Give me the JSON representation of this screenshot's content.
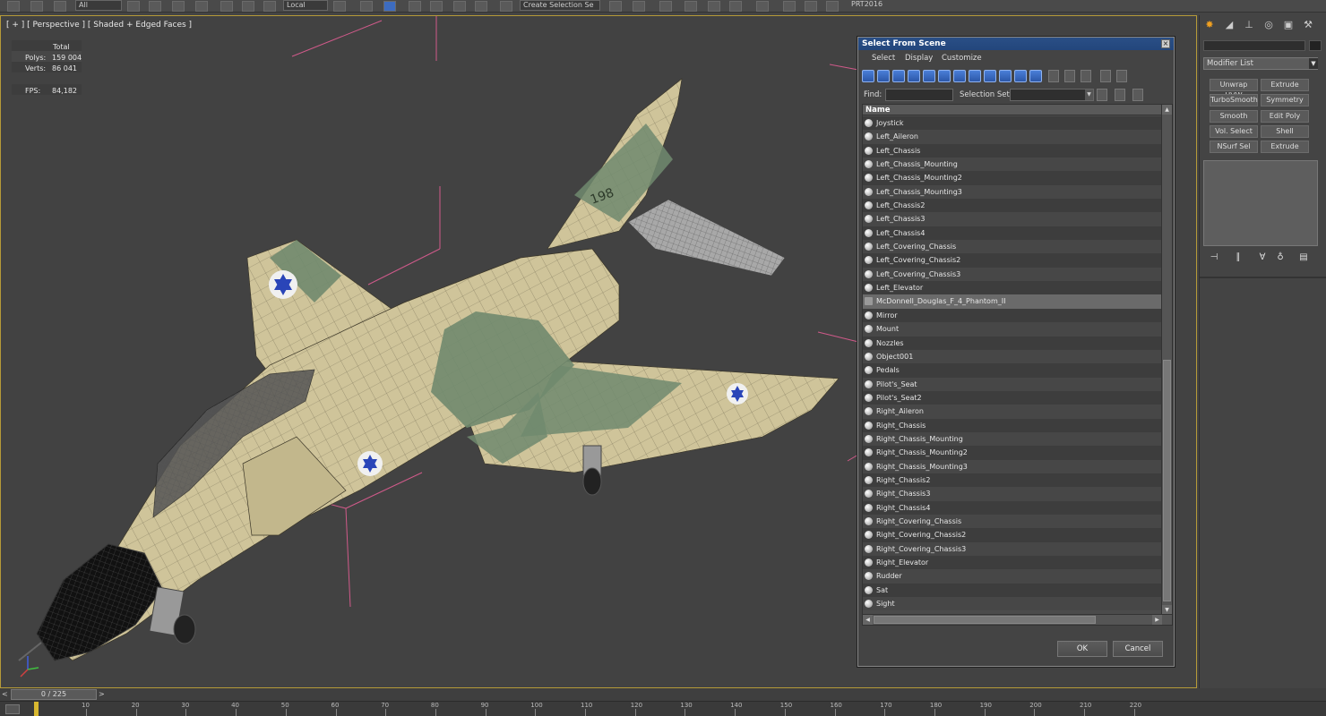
{
  "toolbar": {
    "selection_filter": "All",
    "ref_coord": "Local",
    "named_selection": "Create Selection Se",
    "right_label": "PRT2016"
  },
  "viewport": {
    "label": "[ + ] [ Perspective ] [ Shaded + Edged Faces ]",
    "stats": {
      "total_label": "Total",
      "polys_label": "Polys:",
      "polys_value": "159 004",
      "verts_label": "Verts:",
      "verts_value": "86 041",
      "fps_label": "FPS:",
      "fps_value": "84,182"
    },
    "tail_number": "198"
  },
  "command_panel": {
    "modifier_list": "Modifier List",
    "modifier_buttons": [
      "Unwrap UVW",
      "Extrude",
      "TurboSmooth",
      "Symmetry",
      "Smooth",
      "Edit Poly",
      "Vol. Select",
      "Shell",
      "NSurf Sel",
      "Extrude"
    ]
  },
  "dialog": {
    "title": "Select From Scene",
    "menu": [
      "Select",
      "Display",
      "Customize"
    ],
    "find_label": "Find:",
    "find_value": "",
    "selection_set_label": "Selection Set:",
    "column_name": "Name",
    "selected_item": "McDonnell_Douglas_F_4_Phantom_II",
    "items": [
      "Joystick",
      "Left_Aileron",
      "Left_Chassis",
      "Left_Chassis_Mounting",
      "Left_Chassis_Mounting2",
      "Left_Chassis_Mounting3",
      "Left_Chassis2",
      "Left_Chassis3",
      "Left_Chassis4",
      "Left_Covering_Chassis",
      "Left_Covering_Chassis2",
      "Left_Covering_Chassis3",
      "Left_Elevator",
      "McDonnell_Douglas_F_4_Phantom_II",
      "Mirror",
      "Mount",
      "Nozzles",
      "Object001",
      "Pedals",
      "Pilot's_Seat",
      "Pilot's_Seat2",
      "Right_Aileron",
      "Right_Chassis",
      "Right_Chassis_Mounting",
      "Right_Chassis_Mounting2",
      "Right_Chassis_Mounting3",
      "Right_Chassis2",
      "Right_Chassis3",
      "Right_Chassis4",
      "Right_Covering_Chassis",
      "Right_Covering_Chassis2",
      "Right_Covering_Chassis3",
      "Right_Elevator",
      "Rudder",
      "Sat",
      "Sight"
    ],
    "ok_label": "OK",
    "cancel_label": "Cancel"
  },
  "timeline": {
    "frame_display": "0 / 225",
    "prev": "<",
    "next": ">",
    "ruler_labels": [
      "10",
      "20",
      "30",
      "40",
      "50",
      "60",
      "70",
      "80",
      "90",
      "100",
      "110",
      "120",
      "130",
      "140",
      "150",
      "160",
      "170",
      "180",
      "190",
      "200",
      "210",
      "220"
    ]
  },
  "colors": {
    "viewport_border": "#b59a38",
    "stats_text": "#e8c800",
    "dialog_title_bar": "#2a4f86",
    "camo_sand": "#cfc49a",
    "camo_green": "#708a6e",
    "roundel_blue": "#2a45b8"
  }
}
